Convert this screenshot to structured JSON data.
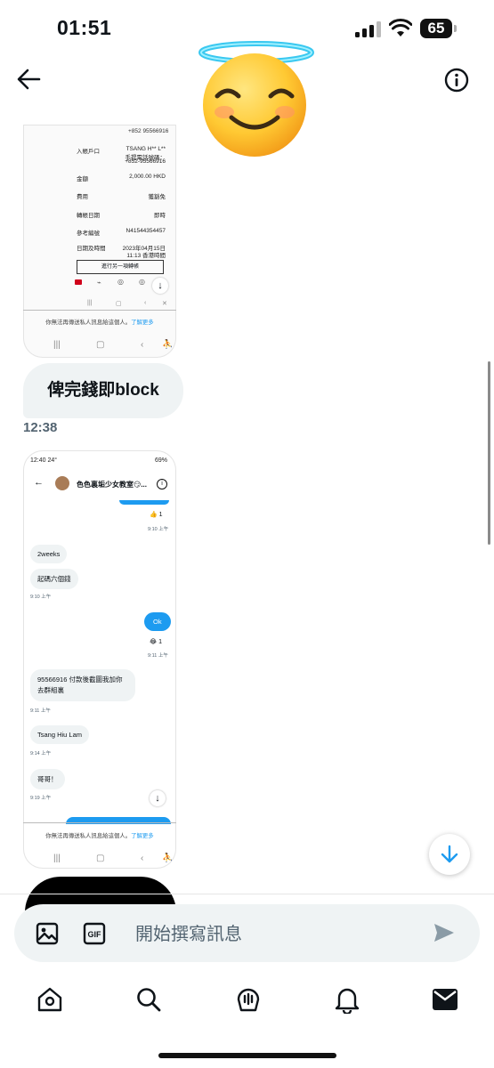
{
  "status_bar": {
    "time": "01:51",
    "battery": "65"
  },
  "card1": {
    "top_line": "+852 95566916",
    "rows": [
      {
        "k": "入帳戶口",
        "v": "TSANG H** L**"
      },
      {
        "k": "",
        "v": "手提電話號碼："
      },
      {
        "k": "",
        "v": "+852-95566916"
      },
      {
        "k": "金額",
        "v": "2,000.00 HKD"
      },
      {
        "k": "費用",
        "v": "獲豁免"
      },
      {
        "k": "轉帳日期",
        "v": "即時"
      },
      {
        "k": "參考編號",
        "v": "N41544354457"
      },
      {
        "k": "日期及時間",
        "v": "2023年04月15日"
      },
      {
        "k": "",
        "v": "11:13 香港時間"
      }
    ],
    "button": "進行另一項轉帳",
    "notice": "你無法再傳送私人訊息給這個人。",
    "notice_link": "了解更多"
  },
  "message": {
    "text": "俾完錢即block",
    "time": "12:38"
  },
  "card2": {
    "status_time": "12:40",
    "status_temp": "24°",
    "status_battery": "69%",
    "chat_title": "色色裏垢少女教室😏...",
    "messages": [
      {
        "text": "2weeks"
      },
      {
        "text": "起碼六個錢"
      },
      {
        "text": "Ok"
      },
      {
        "text": "95566916 付款後截圖我加你去群組裏"
      },
      {
        "text": "Tsang Hiu Lam"
      },
      {
        "text": "哥哥！"
      }
    ],
    "times": [
      "9:10 上午",
      "9:10 上午",
      "9:11 上午",
      "9:11 上午",
      "9:14 上午",
      "9:19 上午"
    ],
    "reaction_counts": [
      "1",
      "1"
    ],
    "notice": "你無法再傳送私人訊息給這個人。",
    "notice_link": "了解更多"
  },
  "composer": {
    "placeholder": "開始撰寫訊息"
  },
  "colors": {
    "accent": "#1d9bf0",
    "bubble": "#eff3f4",
    "muted": "#536471"
  },
  "icons": [
    "back-arrow-icon",
    "info-icon",
    "image-icon",
    "gif-icon",
    "send-icon",
    "home-icon",
    "search-icon",
    "communities-icon",
    "bell-icon",
    "mail-icon",
    "arrow-down-icon"
  ]
}
